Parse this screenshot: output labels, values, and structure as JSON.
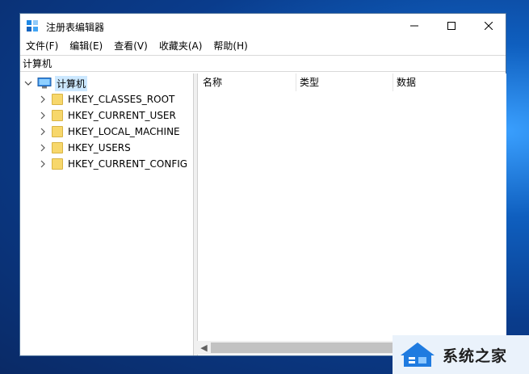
{
  "window": {
    "title": "注册表编辑器",
    "controls": {
      "minimize": "—",
      "maximize": "☐",
      "close": "✕"
    }
  },
  "menu": [
    "文件(F)",
    "编辑(E)",
    "查看(V)",
    "收藏夹(A)",
    "帮助(H)"
  ],
  "address": "计算机",
  "tree": {
    "root": "计算机",
    "items": [
      "HKEY_CLASSES_ROOT",
      "HKEY_CURRENT_USER",
      "HKEY_LOCAL_MACHINE",
      "HKEY_USERS",
      "HKEY_CURRENT_CONFIG"
    ]
  },
  "list": {
    "columns": [
      "名称",
      "类型",
      "数据"
    ]
  },
  "watermark": {
    "text": "系统之家"
  },
  "colors": {
    "folder": "#f7d76b",
    "selection": "#cce8ff",
    "accent": "#0078d7"
  }
}
